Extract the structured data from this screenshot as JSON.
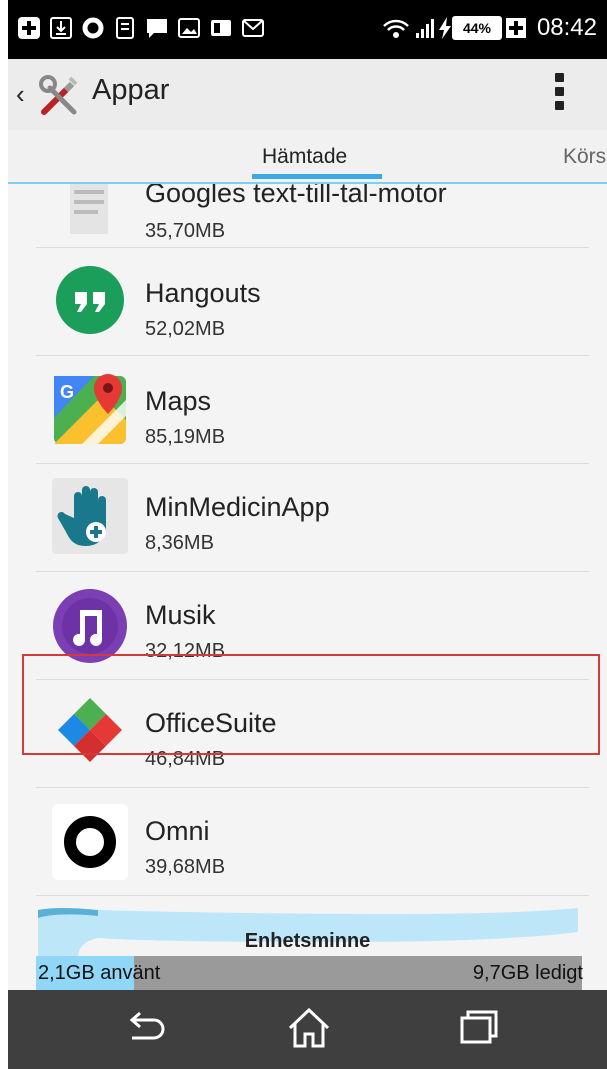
{
  "status_bar": {
    "time": "08:42",
    "battery": "44%",
    "icons": [
      "plus-icon",
      "download-icon",
      "circle-icon",
      "doc-icon",
      "chat-icon",
      "image-icon",
      "card-icon",
      "mail-icon",
      "wifi-icon",
      "signal-icon",
      "charging-icon",
      "battery-icon",
      "battery-plus-icon"
    ]
  },
  "action_bar": {
    "title": "Appar",
    "icon": "tools-icon"
  },
  "tabs": {
    "active": "Hämtade",
    "next": "Körs",
    "accent": "#3ba9e5"
  },
  "apps": [
    {
      "name": "Googles text-till-tal-motor",
      "size": "35,70MB",
      "icon": "tts-icon"
    },
    {
      "name": "Hangouts",
      "size": "52,02MB",
      "icon": "hangouts-icon"
    },
    {
      "name": "Maps",
      "size": "85,19MB",
      "icon": "maps-icon"
    },
    {
      "name": "MinMedicinApp",
      "size": "8,36MB",
      "icon": "minmedicin-icon",
      "highlighted": true
    },
    {
      "name": "Musik",
      "size": "32,12MB",
      "icon": "music-icon"
    },
    {
      "name": "OfficeSuite",
      "size": "46,84MB",
      "icon": "officesuite-icon"
    },
    {
      "name": "Omni",
      "size": "39,68MB",
      "icon": "omni-icon"
    }
  ],
  "storage": {
    "title": "Enhetsminne",
    "used": "2,1GB använt",
    "free": "9,7GB ledigt",
    "used_fraction": 0.18,
    "used_color": "#8fd6f7"
  },
  "nav": {
    "buttons": [
      "back-icon",
      "home-icon",
      "recents-icon"
    ]
  }
}
